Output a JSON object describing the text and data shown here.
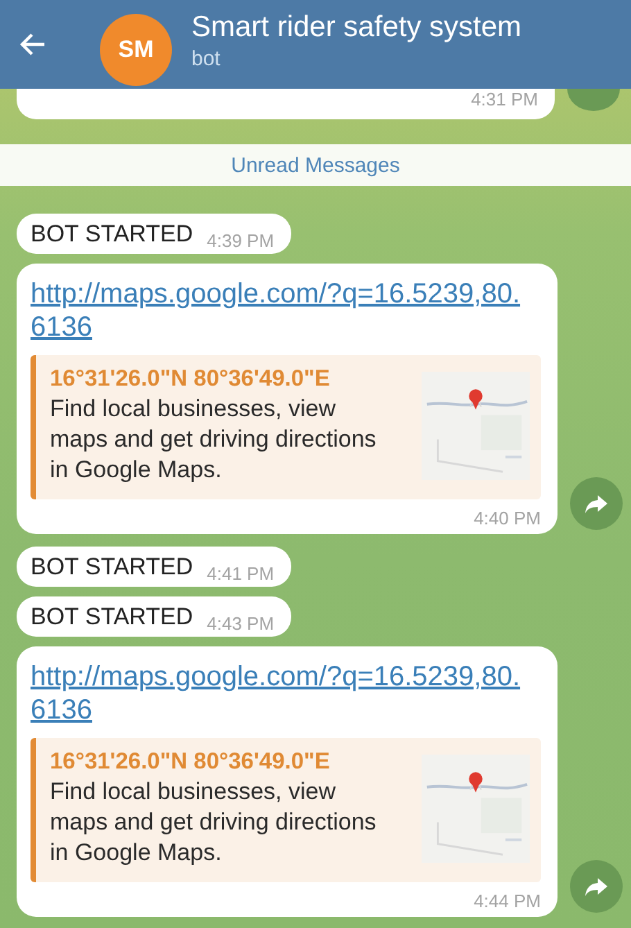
{
  "header": {
    "title": "Smart rider safety system",
    "subtitle": "bot",
    "avatar_initials": "SM"
  },
  "messages": [
    {
      "kind": "stub",
      "time": "4:31 PM",
      "forwardable": true
    },
    {
      "kind": "divider",
      "label": "Unread Messages"
    },
    {
      "kind": "text",
      "text": "BOT STARTED",
      "time": "4:39 PM"
    },
    {
      "kind": "link",
      "url": "http://maps.google.com/?q=16.5239,80.6136",
      "preview": {
        "title": "16°31'26.0\"N 80°36'49.0\"E",
        "description": "Find local businesses, view maps and get driving directions in Google Maps."
      },
      "time": "4:40 PM",
      "forwardable": true
    },
    {
      "kind": "text",
      "text": "BOT STARTED",
      "time": "4:41 PM"
    },
    {
      "kind": "text",
      "text": "BOT STARTED",
      "time": "4:43 PM"
    },
    {
      "kind": "link",
      "url": "http://maps.google.com/?q=16.5239,80.6136",
      "preview": {
        "title": "16°31'26.0\"N 80°36'49.0\"E",
        "description": "Find local businesses, view maps and get driving directions in Google Maps."
      },
      "time": "4:44 PM",
      "forwardable": true
    }
  ]
}
